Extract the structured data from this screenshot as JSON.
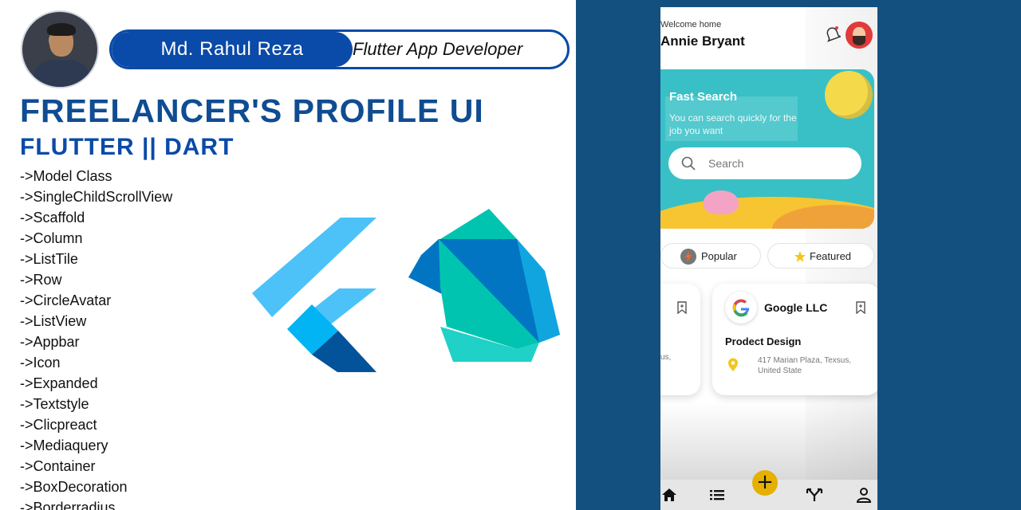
{
  "profile": {
    "name": "Md. Rahul Reza",
    "role": "Flutter App Developer"
  },
  "heading": {
    "title": "FREELANCER'S PROFILE UI",
    "subtitle": "FLUTTER || DART"
  },
  "topics": [
    "->Model Class",
    "->SingleChildScrollView",
    "->Scaffold",
    "->Column",
    "->ListTile",
    "->Row",
    "->CircleAvatar",
    "->ListView",
    "->Appbar",
    "->Icon",
    "->Expanded",
    "->Textstyle",
    "->Clicpreact",
    "->Mediaquery",
    "->Container",
    "->BoxDecoration",
    "->Borderradius"
  ],
  "app": {
    "welcome": "Welcome home",
    "user_name": "Annie Bryant",
    "hero": {
      "title": "Fast Search",
      "text": "You can search quickly for the job you want",
      "search_placeholder": "Search"
    },
    "chips": {
      "popular": "Popular",
      "featured": "Featured"
    },
    "cards": {
      "left_fragment": "us,",
      "right": {
        "company": "Google LLC",
        "job": "Prodect Design",
        "address": "417 Marian Plaza, Texsus, United State"
      }
    },
    "nav": {
      "add_glyph": "+"
    }
  },
  "colors": {
    "brand_blue": "#0a4aa8",
    "title_blue": "#0f4c92",
    "panel_bg": "#14507f",
    "hero_teal": "#38c0c6",
    "accent_yellow": "#e5b000"
  },
  "icons": {
    "bell": "bell-icon",
    "search": "search-icon",
    "popular": "bolt-icon",
    "featured": "star-icon",
    "bookmark": "bookmark-icon",
    "pin": "location-pin-icon",
    "nav": [
      "home-icon",
      "list-icon",
      "add-icon",
      "share-icon",
      "profile-icon"
    ]
  }
}
